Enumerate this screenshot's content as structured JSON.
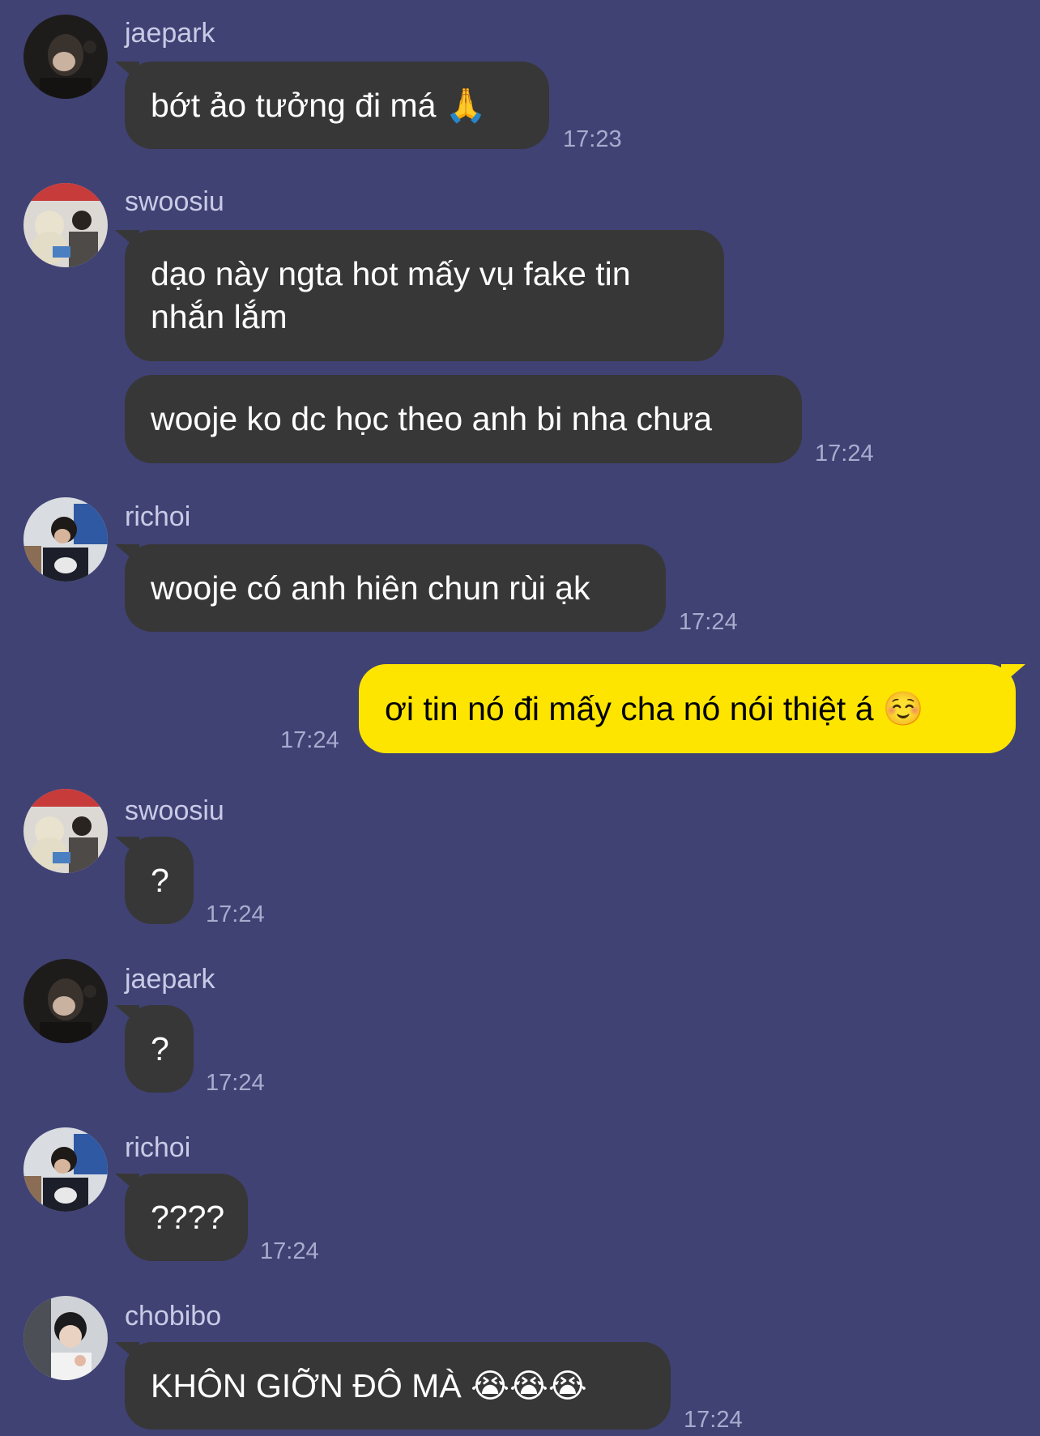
{
  "chat": {
    "messages": [
      {
        "sender": "jaepark",
        "texts": [
          "bớt ảo tưởng đi má 🙏"
        ],
        "time": "17:23"
      },
      {
        "sender": "swoosiu",
        "texts": [
          "dạo này ngta hot mấy vụ fake tin nhắn lắm",
          "wooje ko dc học theo anh bi nha chưa"
        ],
        "time": "17:24"
      },
      {
        "sender": "richoi",
        "texts": [
          "wooje có anh hiên chun rùi ạk"
        ],
        "time": "17:24"
      },
      {
        "sender": "me",
        "texts": [
          "ơi tin nó đi mấy cha nó nói thiệt á ☺️"
        ],
        "time": "17:24"
      },
      {
        "sender": "swoosiu",
        "texts": [
          "?"
        ],
        "time": "17:24"
      },
      {
        "sender": "jaepark",
        "texts": [
          "?"
        ],
        "time": "17:24"
      },
      {
        "sender": "richoi",
        "texts": [
          "????"
        ],
        "time": "17:24"
      },
      {
        "sender": "chobibo",
        "texts": [
          "KHÔN GIỠN ĐÔ MÀ 😭😭😭"
        ],
        "time": "17:24"
      }
    ]
  },
  "colors": {
    "background": "#404274",
    "incoming_bubble": "#373737",
    "outgoing_bubble": "#fee500",
    "sender_text": "#c9cbe6",
    "time_text": "#a9abce"
  },
  "icons": {
    "avatar_jaepark": "avatar-photo",
    "avatar_swoosiu": "avatar-photo",
    "avatar_richoi": "avatar-photo",
    "avatar_chobibo": "avatar-photo"
  }
}
